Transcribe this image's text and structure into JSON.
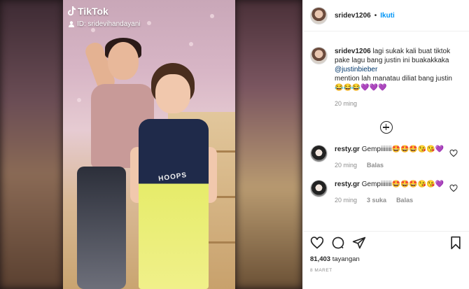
{
  "video": {
    "tiktok_brand": "TikTok",
    "tiktok_id": "ID: sridevihandayani",
    "jersey_text": "HOOPS"
  },
  "post": {
    "author": "sridev1206",
    "separator": "•",
    "follow_label": "Ikuti",
    "caption_text": " lagi sukak kali buat tiktok pake lagu bang justin ini buakakkaka",
    "caption_mention": "@justinbieber",
    "caption_line3": "mention lah manatau diliat bang justin",
    "caption_emoji": "😂😂😂💜💜💜",
    "caption_time": "20 ming"
  },
  "comments": [
    {
      "user": "resty.gr",
      "text": " Gempiiiiiii🤩🤩🤩😘😘💜",
      "time": "20 ming",
      "likes": "",
      "reply_label": "Balas"
    },
    {
      "user": "resty.gr",
      "text": " Gempiiiiiii🤩🤩🤩😘😘💜",
      "time": "20 ming",
      "likes": "3 suka",
      "reply_label": "Balas"
    }
  ],
  "stats": {
    "views_count": "81,403",
    "views_label": " tayangan",
    "date": "8 MARET"
  },
  "icons": [
    "heart-icon",
    "comment-icon",
    "share-icon",
    "bookmark-icon",
    "plus-circle-icon",
    "tiktok-note-icon",
    "user-icon"
  ],
  "colors": {
    "link": "#0095f6",
    "text": "#262626",
    "muted": "#8e8e8e",
    "border": "#efefef"
  }
}
